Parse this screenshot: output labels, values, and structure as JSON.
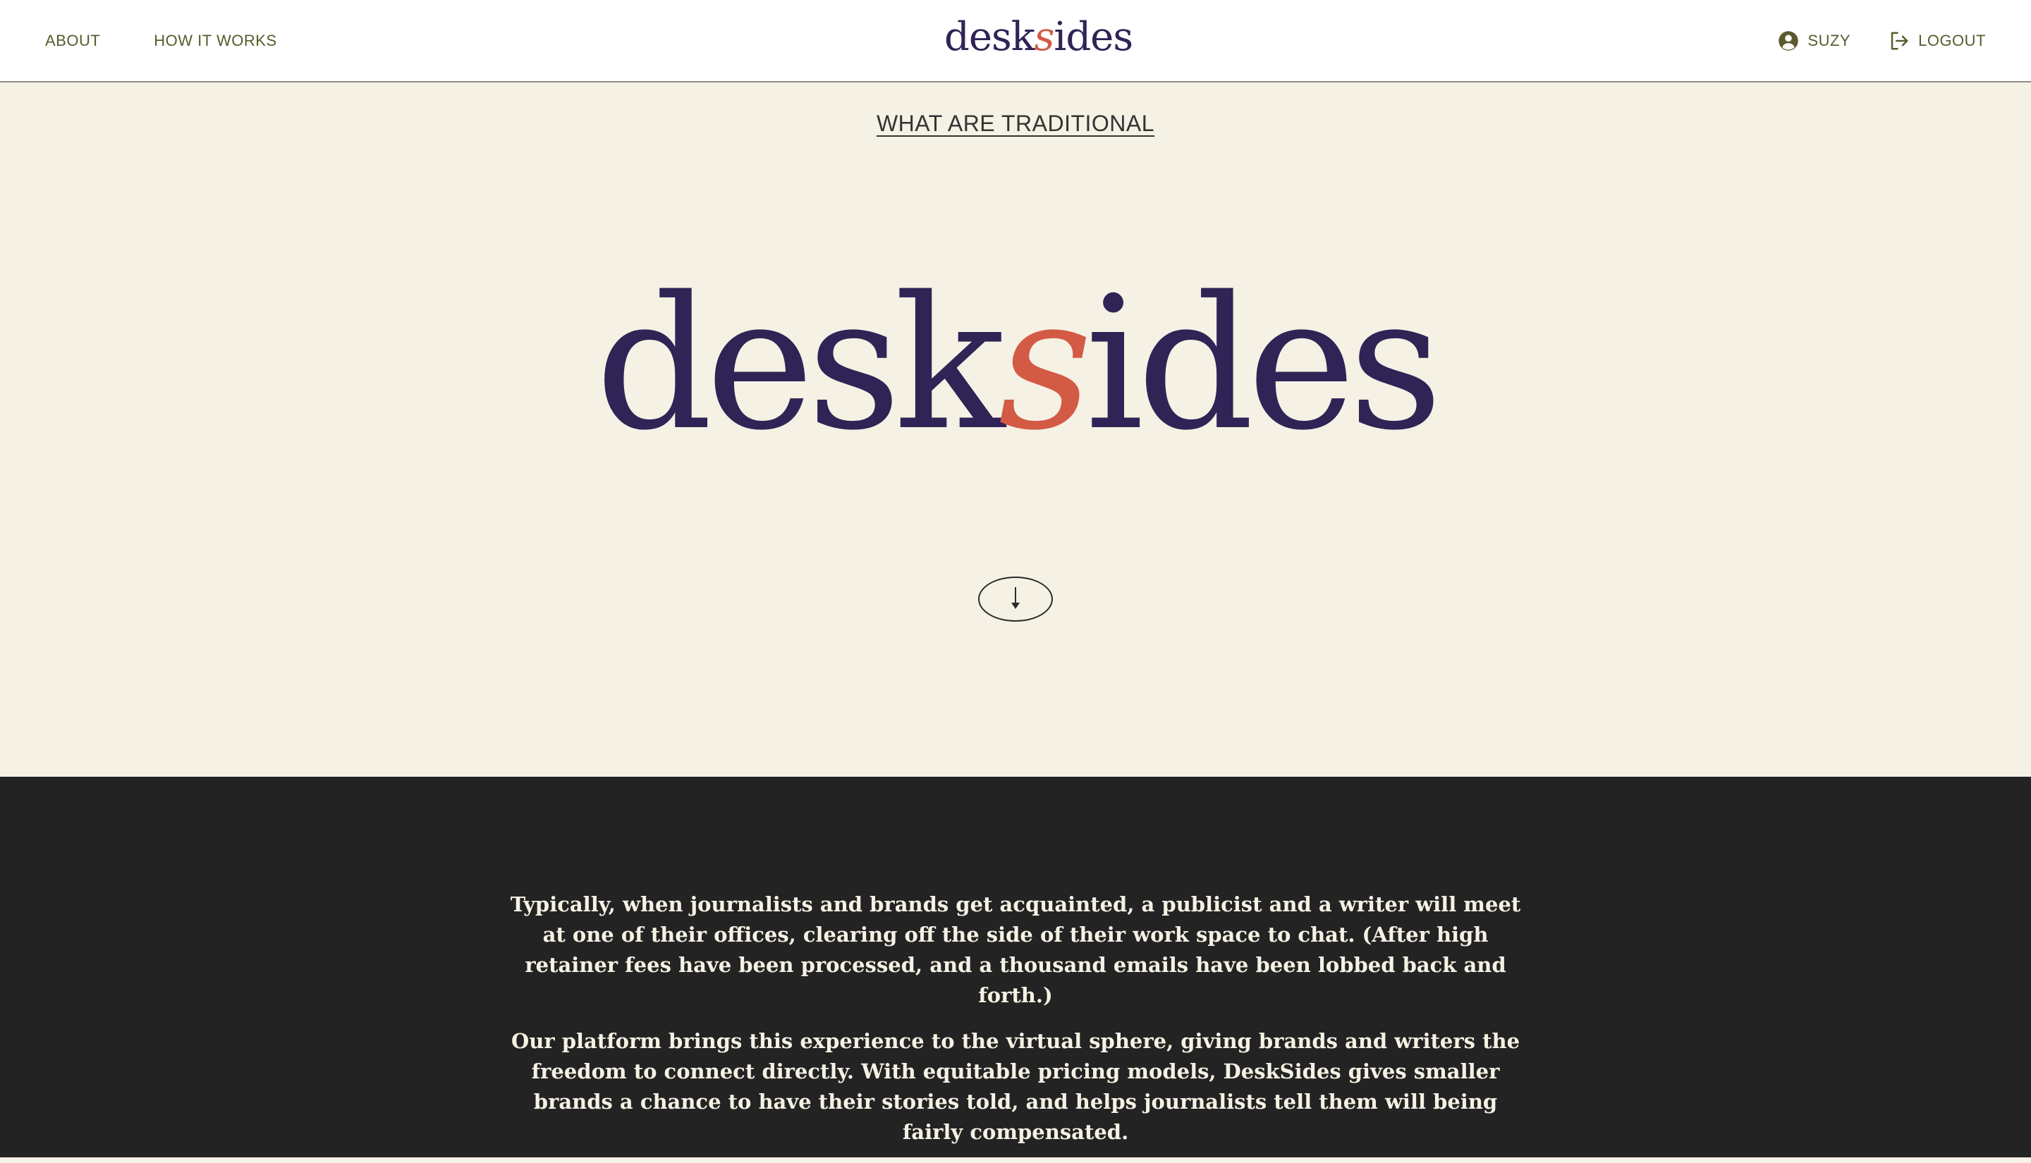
{
  "header": {
    "nav_left": [
      {
        "label": "ABOUT"
      },
      {
        "label": "HOW IT WORKS"
      }
    ],
    "logo": {
      "before": "desk",
      "accent": "s",
      "after": "ides"
    },
    "user": {
      "label": "SUZY",
      "icon": "user-circle-icon"
    },
    "logout": {
      "label": "LOGOUT",
      "icon": "logout-icon"
    }
  },
  "hero": {
    "heading": "WHAT ARE TRADITIONAL",
    "logo": {
      "before": "desk",
      "accent": "s",
      "after": "ides"
    },
    "scroll_icon": "arrow-down-icon"
  },
  "about": {
    "paragraphs": [
      "Typically, when journalists and brands get acquainted, a publicist and a writer will meet at one of their offices, clearing off the side of their work space to chat. (After high retainer fees have been processed, and a thousand emails have been lobbed back and forth.)",
      "Our platform brings this experience to the virtual sphere, giving brands and writers the freedom to connect directly. With equitable pricing models, DeskSides gives smaller brands a chance to have their stories told, and helps journalists tell them will being fairly compensated."
    ]
  },
  "colors": {
    "brand_purple": "#302356",
    "brand_accent": "#d35a45",
    "cream_background": "#f5f1e4",
    "dark_background": "#232323",
    "nav_text": "#5a5a2e"
  }
}
